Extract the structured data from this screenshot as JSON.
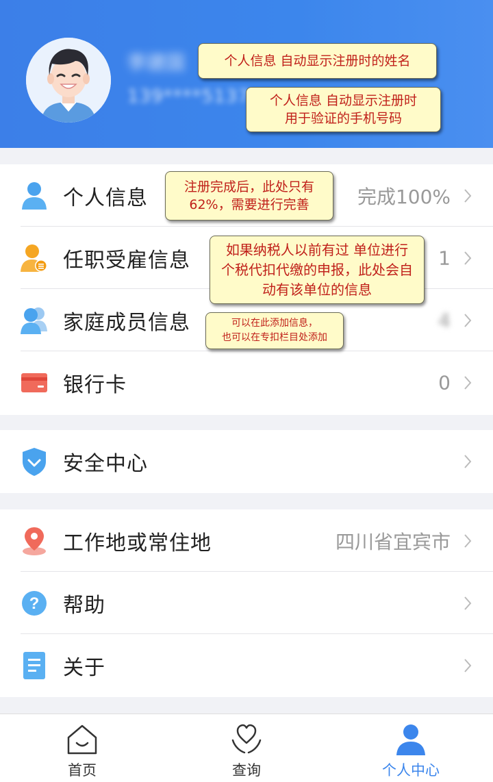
{
  "profile": {
    "name": "李建国",
    "phone": "139****5137"
  },
  "callouts": {
    "name_note": "个人信息  自动显示注册时的姓名",
    "phone_note_line1": "个人信息  自动显示注册时",
    "phone_note_line2": "用于验证的手机号码",
    "personal_note_line1": "注册完成后，此处只有",
    "personal_note_line2": "62%，需要进行完善",
    "employment_note_line1": "如果纳税人以前有过 单位进行",
    "employment_note_line2": "个税代扣代缴的申报，此处会自",
    "employment_note_line3": "动有该单位的信息",
    "family_note_line1": "可以在此添加信息，",
    "family_note_line2": "也可以在专扣栏目处添加"
  },
  "menu": {
    "personal_info": {
      "label": "个人信息",
      "value": "完成100%"
    },
    "employment": {
      "label": "任职受雇信息",
      "value": "1"
    },
    "family": {
      "label": "家庭成员信息",
      "value": "4"
    },
    "bank_card": {
      "label": "银行卡",
      "value": "0"
    },
    "security": {
      "label": "安全中心"
    },
    "location": {
      "label": "工作地或常住地",
      "value": "四川省宜宾市"
    },
    "help": {
      "label": "帮助"
    },
    "about": {
      "label": "关于"
    }
  },
  "tabs": {
    "home": "首页",
    "query": "查询",
    "me": "个人中心"
  },
  "colors": {
    "primary": "#3c86ec",
    "callout_bg": "#fffbc9",
    "callout_text": "#c0201a"
  }
}
